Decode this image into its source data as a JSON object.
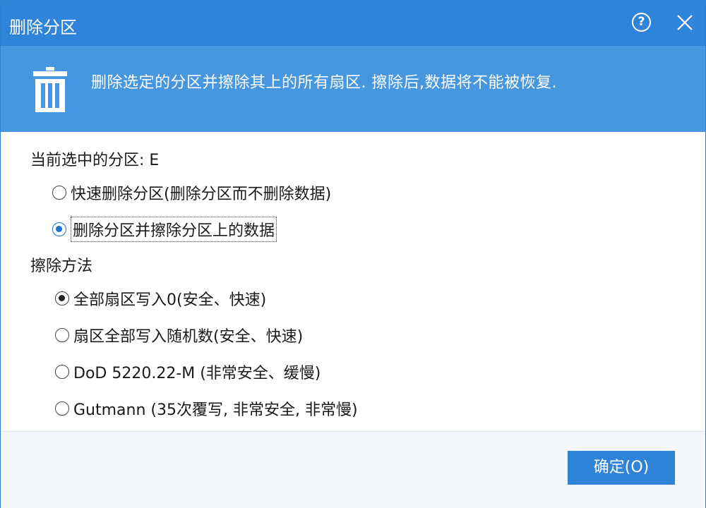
{
  "window": {
    "title": "删除分区",
    "help_glyph": "?"
  },
  "banner": {
    "icon": "trash-icon",
    "text": "删除选定的分区并擦除其上的所有扇区. 擦除后,数据将不能被恢复."
  },
  "partition": {
    "label": "当前选中的分区: E",
    "options": [
      {
        "label": "快速删除分区(删除分区而不删除数据)",
        "selected": false
      },
      {
        "label": "删除分区并擦除分区上的数据",
        "selected": true
      }
    ]
  },
  "wipe": {
    "label": "擦除方法",
    "options": [
      {
        "label": "全部扇区写入0(安全、快速)",
        "selected": true
      },
      {
        "label": "扇区全部写入随机数(安全、快速)",
        "selected": false
      },
      {
        "label": "DoD 5220.22-M (非常安全、缓慢)",
        "selected": false
      },
      {
        "label": "Gutmann (35次覆写, 非常安全, 非常慢)",
        "selected": false
      }
    ]
  },
  "footer": {
    "ok_label": "确定(O)"
  },
  "colors": {
    "titlebar": "#2f83d8",
    "banner": "#4796e0",
    "accent": "#1a73d0"
  }
}
